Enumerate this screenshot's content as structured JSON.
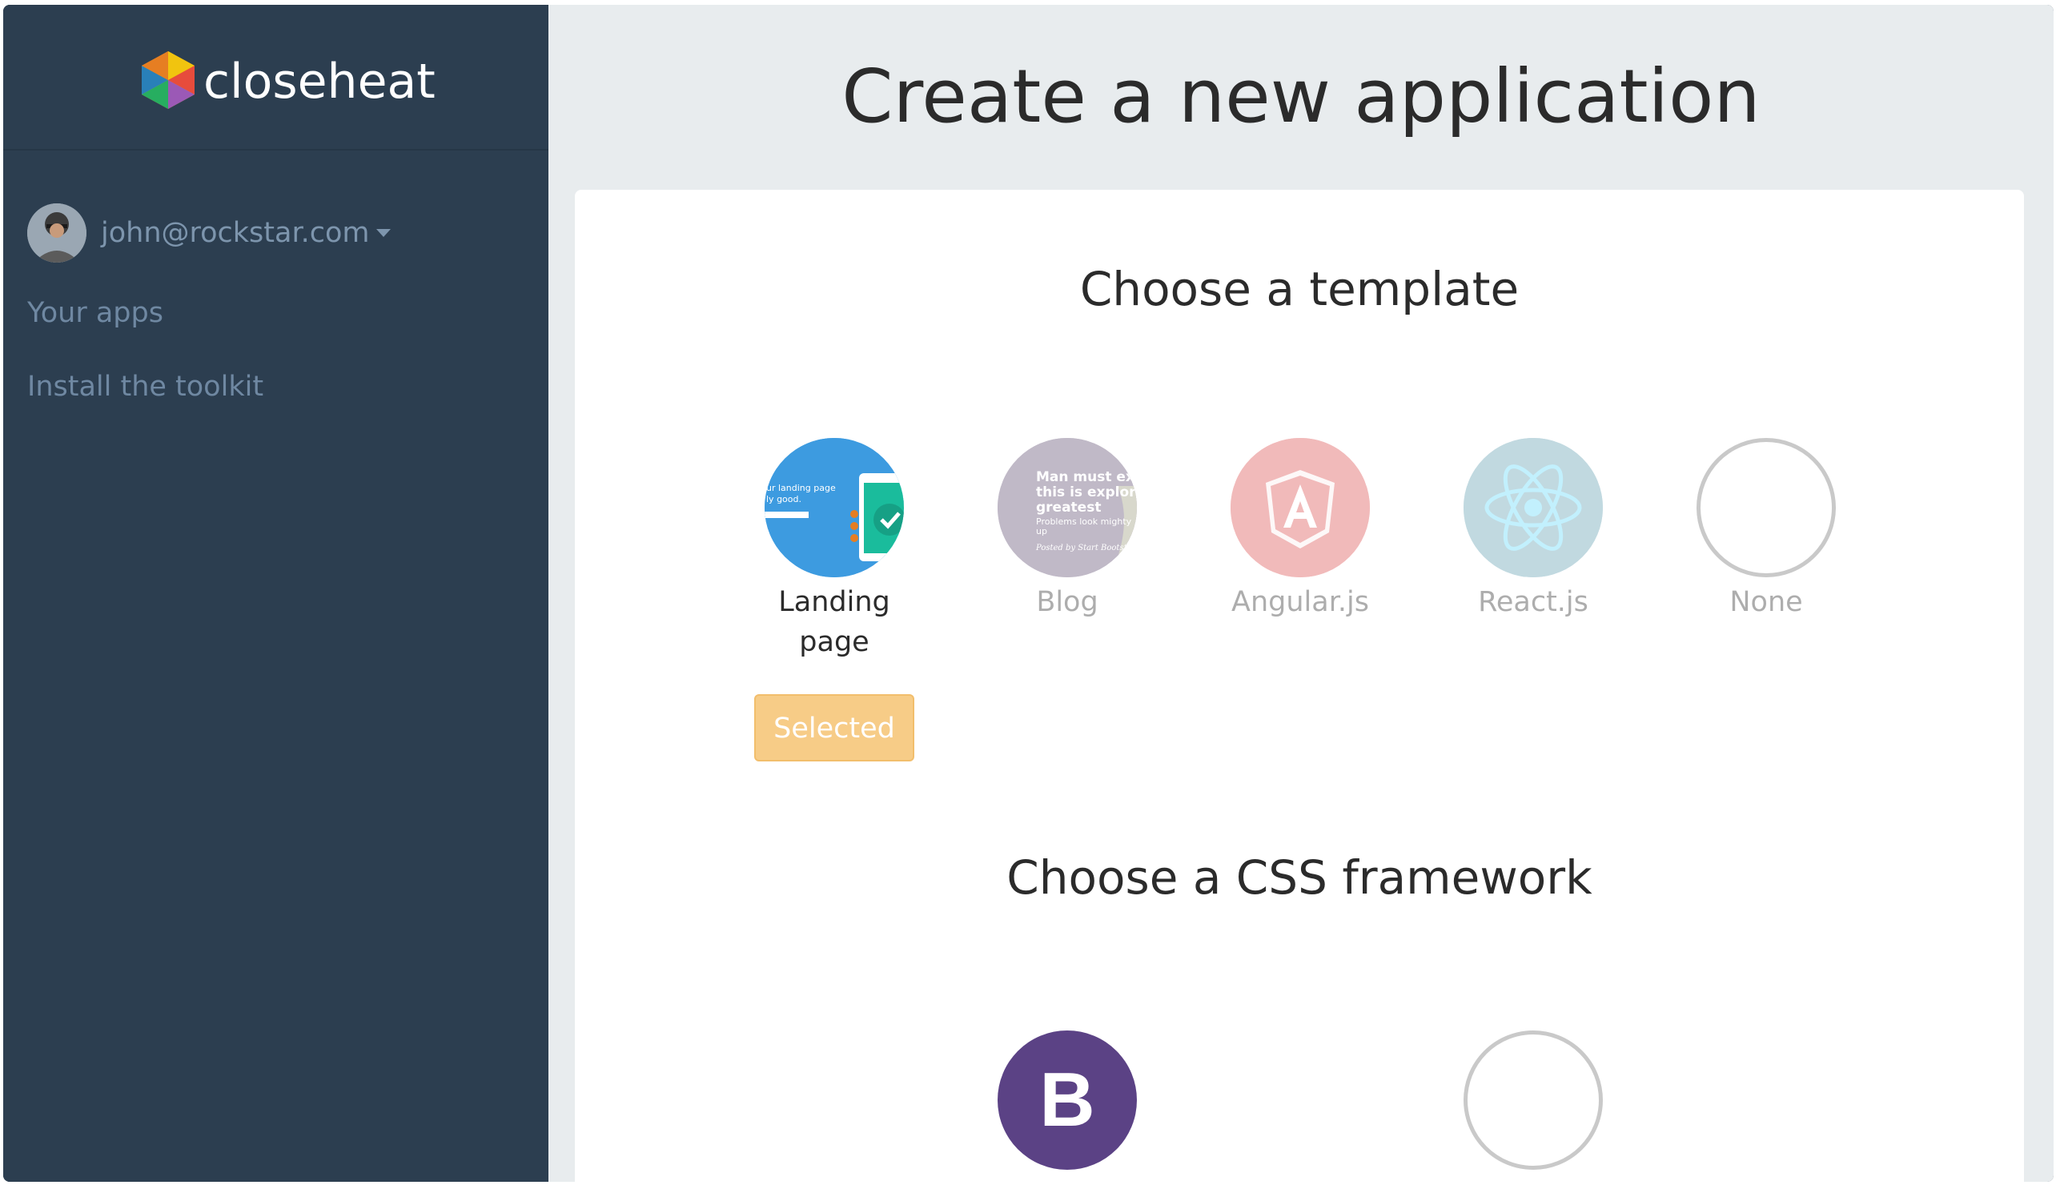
{
  "brand": {
    "name": "closeheat",
    "logo_icon": "hexagon-logo-icon"
  },
  "user": {
    "email": "john@rockstar.com",
    "avatar_icon": "user-avatar"
  },
  "nav": {
    "items": [
      {
        "label": "Your apps"
      },
      {
        "label": "Install the toolkit"
      }
    ]
  },
  "page": {
    "title": "Create a new application"
  },
  "template_section": {
    "title": "Choose a template",
    "options": [
      {
        "label": "Landing page",
        "state": "selected",
        "icon": "landing-page-thumbnail",
        "color": "#3d9be0"
      },
      {
        "label": "Blog",
        "state": "unselected",
        "icon": "blog-thumbnail",
        "color": "#7e6d8f",
        "thumbnail_lines": [
          "Man must ex",
          "this is explora",
          "greatest",
          "Problems look mighty",
          "up",
          "Posted by Start Bootstr"
        ]
      },
      {
        "label": "Angular.js",
        "state": "unselected",
        "icon": "angular-icon",
        "color": "#dd4b4b"
      },
      {
        "label": "React.js",
        "state": "unselected",
        "icon": "react-icon",
        "color": "#5e9cb0"
      },
      {
        "label": "None",
        "state": "unselected",
        "icon": "empty-circle-icon",
        "color": "#b5b5b5"
      }
    ],
    "thumbnail_text": "ur landing page\nly good.",
    "selected_label": "Selected"
  },
  "css_section": {
    "title": "Choose a CSS framework",
    "options": [
      {
        "label": "B",
        "icon": "bootstrap-icon",
        "color": "#5b4285"
      },
      {
        "label": "",
        "icon": "empty-circle-icon",
        "color": "#c9c9c9"
      }
    ]
  },
  "colors": {
    "sidebar": "#2c3e50",
    "main_bg": "#e8ecee",
    "accent_selected": "#f7cc87",
    "nav_text": "#6f88a2"
  }
}
